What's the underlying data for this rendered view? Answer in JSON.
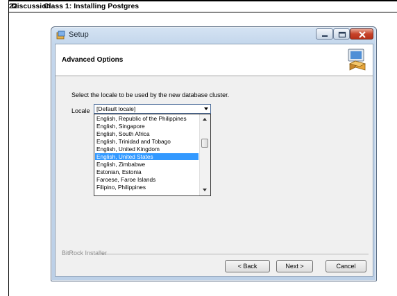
{
  "slide": {
    "number": "22",
    "heading_word": "Discussion",
    "heading_title": "Class 1: Installing Postgres"
  },
  "window": {
    "title": "Setup",
    "controls": [
      "minimize",
      "maximize",
      "close"
    ]
  },
  "header": {
    "section_title": "Advanced Options"
  },
  "form": {
    "prompt": "Select the locale to be used by the new database cluster.",
    "locale_label": "Locale",
    "locale_value": "[Default locale]",
    "dropdown_items": [
      "English, Republic of the Philippines",
      "English, Singapore",
      "English, South Africa",
      "English, Trinidad and Tobago",
      "English, United Kingdom",
      "English, United States",
      "English, Zimbabwe",
      "Estonian, Estonia",
      "Faroese, Faroe Islands",
      "Filipino, Philippines"
    ],
    "highlighted_item": "English, United States"
  },
  "footer": {
    "installer_label": "BitRock Installer",
    "back_label": "< Back",
    "next_label": "Next >",
    "cancel_label": "Cancel"
  },
  "colors": {
    "selection": "#3399ff",
    "titlebar": "#c4d7ec",
    "close_button": "#c7432a"
  },
  "icons": [
    "setup-app-icon",
    "minimize-icon",
    "maximize-icon",
    "close-icon",
    "setup-computer-icon",
    "dropdown-arrow-icon",
    "scroll-up-icon",
    "scroll-down-icon"
  ]
}
